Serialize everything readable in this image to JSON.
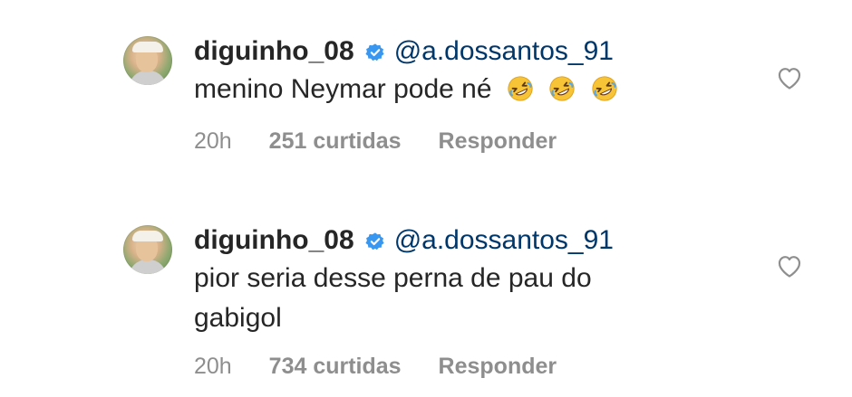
{
  "comments": [
    {
      "username": "diguinho_08",
      "mention": "@a.dossantos_91",
      "text_line1": "menino Neymar pode né",
      "text_line2": "",
      "emojis": [
        "rolling-on-floor-laughing",
        "rolling-on-floor-laughing",
        "rolling-on-floor-laughing"
      ],
      "time": "20h",
      "likes": "251 curtidas",
      "reply": "Responder"
    },
    {
      "username": "diguinho_08",
      "mention": "@a.dossantos_91",
      "text_line1": "pior seria desse perna de pau do",
      "text_line2": "gabigol",
      "emojis": [],
      "time": "20h",
      "likes": "734 curtidas",
      "reply": "Responder"
    }
  ],
  "colors": {
    "text": "#262626",
    "mention": "#00376b",
    "meta": "#8e8e8e",
    "verified": "#3897f0"
  }
}
